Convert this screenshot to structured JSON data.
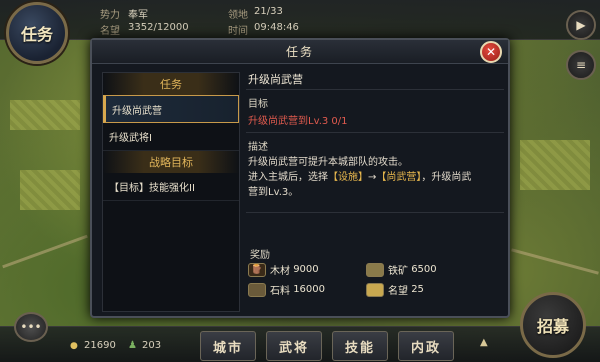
{
  "top_bar": {
    "quest_badge_label": "任务",
    "faction_label": "势力",
    "faction_value": "奉军",
    "fame_label": "名望",
    "fame_value": "3352/12000",
    "territory_label": "领地",
    "territory_value": "21/33",
    "time_label": "时间",
    "time_value": "09:48:46"
  },
  "dialog": {
    "title": "任务",
    "close_icon": "close-icon",
    "left_panel": {
      "quests_header": "任务",
      "quests": [
        {
          "label": "升级尚武营",
          "selected": true
        },
        {
          "label": "升级武将I",
          "selected": false
        }
      ],
      "strategy_header": "战略目标",
      "strategy_items": [
        {
          "label": "【目标】技能强化II"
        }
      ]
    },
    "detail": {
      "title": "升级尚武营",
      "objective_label": "目标",
      "objective_text": "升级尚武营到Lv.3 0/1",
      "description_label": "描述",
      "description_line1": "升级尚武营可提升本城部队的攻击。",
      "description_line2_prefix": "进入主城后，选择",
      "description_line2_facility": "【设施】",
      "description_line2_arrow": "→",
      "description_line2_target": "【尚武营】",
      "description_line2_suffix": "，升级尚武",
      "description_line3": "营到Lv.3。",
      "rewards_label": "奖励",
      "rewards": [
        {
          "name": "木材",
          "amount": "9000",
          "icon": "wood-icon"
        },
        {
          "name": "铁矿",
          "amount": "6500",
          "icon": "iron-icon"
        },
        {
          "name": "石料",
          "amount": "16000",
          "icon": "stone-icon"
        },
        {
          "name": "名望",
          "amount": "25",
          "icon": "fame-icon"
        }
      ]
    }
  },
  "bottom_bar": {
    "copper_value": "21690",
    "troop_value": "203",
    "tabs": [
      "城市",
      "武将",
      "技能",
      "内政"
    ],
    "recruit_label": "招募"
  },
  "colors": {
    "accent_gold": "#e0b45a",
    "objective_red": "#e05a4e",
    "close_red": "#c83228"
  }
}
